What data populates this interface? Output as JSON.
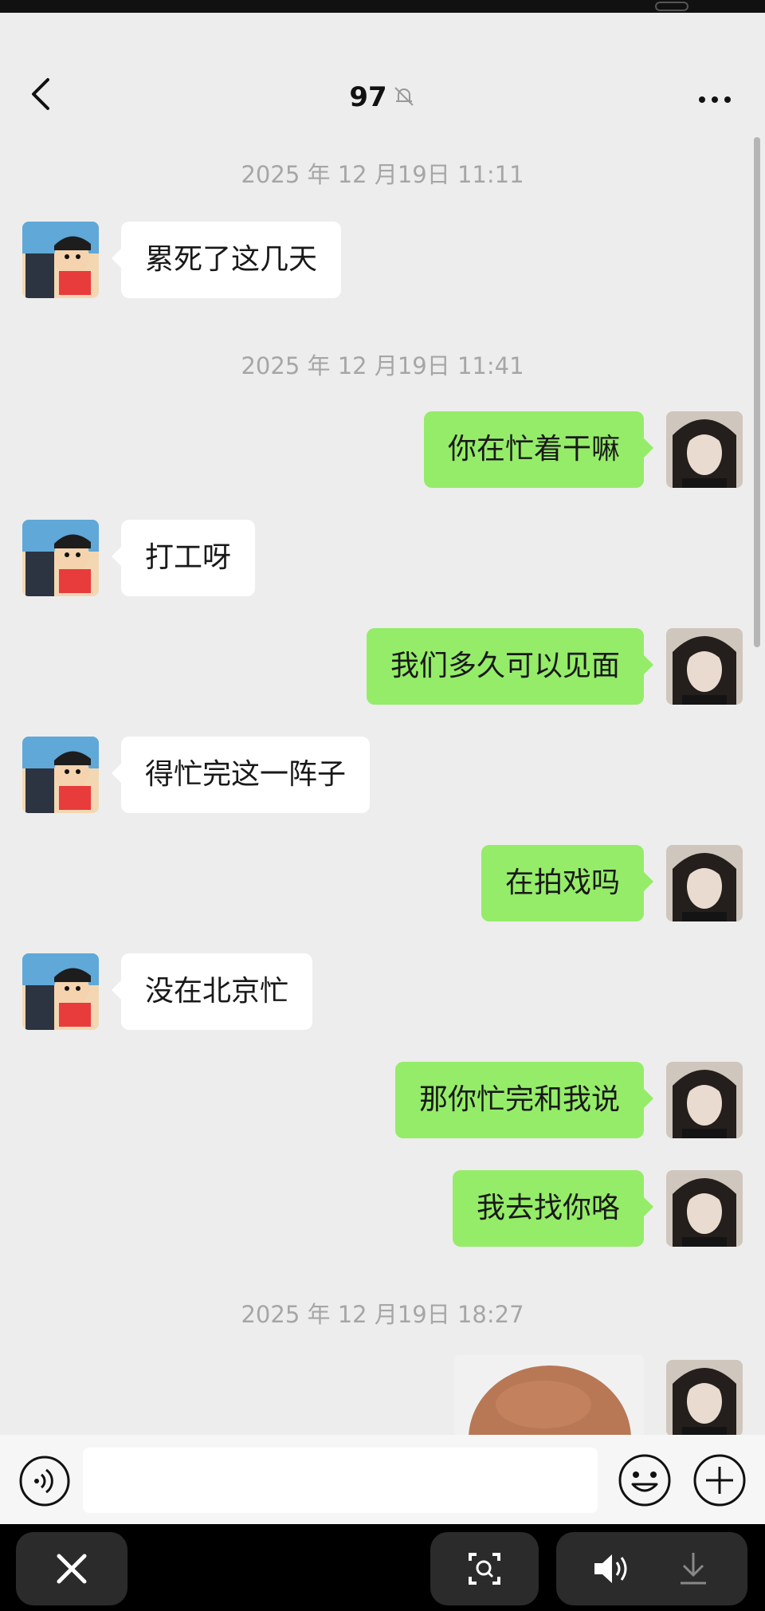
{
  "nav": {
    "title": "97",
    "back_icon": "chevron-left-icon",
    "mute_icon": "bell-muted-icon",
    "more_icon": "more-dots-icon"
  },
  "messages": [
    {
      "type": "time",
      "text": "2025 年 12 月19日 11:11"
    },
    {
      "type": "in",
      "text": "累死了这几天"
    },
    {
      "type": "time",
      "text": "2025 年 12 月19日 11:41"
    },
    {
      "type": "out",
      "text": "你在忙着干嘛"
    },
    {
      "type": "in",
      "text": "打工呀"
    },
    {
      "type": "out",
      "text": "我们多久可以见面"
    },
    {
      "type": "in",
      "text": "得忙完这一阵子"
    },
    {
      "type": "out",
      "text": "在拍戏吗"
    },
    {
      "type": "in",
      "text": "没在北京忙"
    },
    {
      "type": "out",
      "text": "那你忙完和我说"
    },
    {
      "type": "out",
      "text": "我去找你咯"
    },
    {
      "type": "time",
      "text": "2025 年 12 月19日 18:27"
    },
    {
      "type": "out-image",
      "text": ""
    }
  ],
  "input": {
    "voice_icon": "voice-icon",
    "value": "",
    "emoji_icon": "emoji-icon",
    "plus_icon": "plus-circle-icon"
  },
  "viewer_toolbar": {
    "close_icon": "close-icon",
    "scan_icon": "scan-icon",
    "sound_icon": "speaker-icon",
    "download_icon": "download-icon"
  },
  "colors": {
    "background": "#ededed",
    "outgoing_bubble": "#95ec69",
    "incoming_bubble": "#ffffff",
    "timestamp": "#a6a6a6"
  }
}
